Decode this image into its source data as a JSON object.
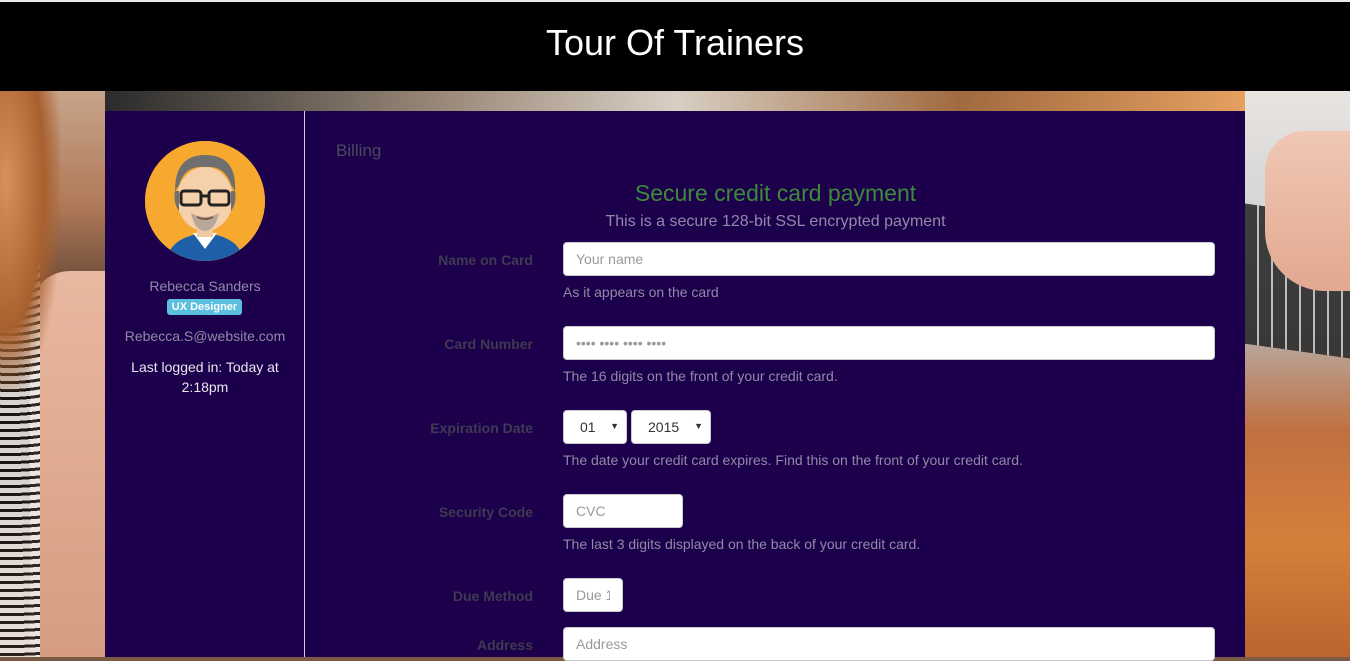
{
  "header": {
    "title": "Tour Of Trainers"
  },
  "profile": {
    "name": "Rebecca Sanders",
    "role": "UX Designer",
    "email": "Rebecca.S@website.com",
    "last_login": "Last logged in: Today at 2:18pm"
  },
  "billing": {
    "section_title": "Billing",
    "title": "Secure credit card payment",
    "subtitle": "This is a secure 128-bit SSL encrypted payment",
    "name_on_card": {
      "label": "Name on Card",
      "placeholder": "Your name",
      "help": "As it appears on the card"
    },
    "card_number": {
      "label": "Card Number",
      "placeholder": "•••• •••• •••• ••••",
      "help": "The 16 digits on the front of your credit card."
    },
    "expiration": {
      "label": "Expiration Date",
      "month": "01",
      "year": "2015",
      "help": "The date your credit card expires. Find this on the front of your credit card."
    },
    "security_code": {
      "label": "Security Code",
      "placeholder": "CVC",
      "help": "The last 3 digits displayed on the back of your credit card."
    },
    "due_method": {
      "label": "Due Method",
      "placeholder": "Due 1"
    },
    "address": {
      "label": "Address",
      "placeholder": "Address"
    }
  }
}
